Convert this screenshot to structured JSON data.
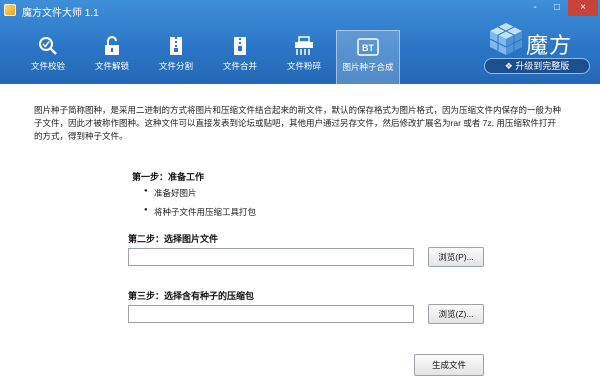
{
  "window": {
    "title": "魔方文件大师 1.1",
    "controls": [
      "-",
      "□",
      "×"
    ]
  },
  "toolbar": {
    "items": [
      {
        "label": "文件校验",
        "icon": "magnifier-check-icon"
      },
      {
        "label": "文件解锁",
        "icon": "unlock-icon"
      },
      {
        "label": "文件分割",
        "icon": "zip-split-icon"
      },
      {
        "label": "文件合并",
        "icon": "zip-merge-icon"
      },
      {
        "label": "文件粉碎",
        "icon": "shredder-icon"
      },
      {
        "label": "图片种子合成",
        "icon": "bt-icon",
        "badge": "BT",
        "active": true
      }
    ]
  },
  "brand": {
    "name": "魔方",
    "upgrade_label": "升级到完整版"
  },
  "intro": "图片种子简称图种，是采用二进制的方式将图片和压缩文件结合起来的新文件，默认的保存格式为图片格式，因为压缩文件内保存的一般为种子文件，因此才被称作图种。这种文件可以直接发表到论坛或贴吧，其他用户通过另存文件，然后修改扩展名为rar 或者 7z, 用压缩软件打开的方式，得到种子文件。",
  "step1": {
    "title": "第一步：准备工作",
    "bullets": [
      "准备好图片",
      "将种子文件用压缩工具打包"
    ]
  },
  "step2": {
    "title": "第二步：选择图片文件",
    "value": "",
    "browse_label": "浏览(P)..."
  },
  "step3": {
    "title": "第三步：选择含有种子的压缩包",
    "value": "",
    "browse_label": "浏览(Z)..."
  },
  "generate_label": "生成文件"
}
